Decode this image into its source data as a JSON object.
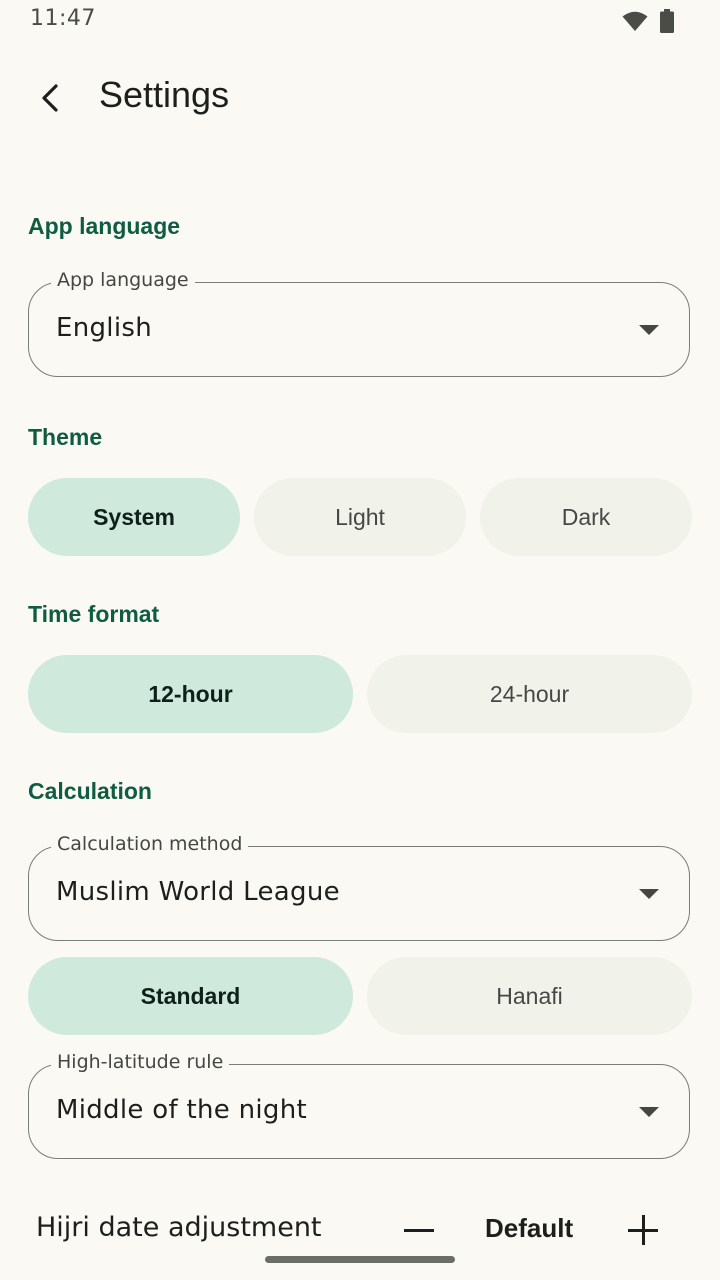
{
  "status_bar": {
    "time": "11:47",
    "icons": [
      "wifi-icon",
      "battery-icon"
    ]
  },
  "header": {
    "title": "Settings",
    "back_icon": "back-arrow-icon"
  },
  "sections": {
    "app_language": "App language",
    "theme": "Theme",
    "time_format": "Time format",
    "calculation": "Calculation"
  },
  "app_language_field": {
    "label": "App language",
    "value": "English"
  },
  "theme_options": {
    "system": "System",
    "light": "Light",
    "dark": "Dark",
    "selected": "System"
  },
  "time_format_options": {
    "h12": "12-hour",
    "h24": "24-hour",
    "selected": "12-hour"
  },
  "calculation_method_field": {
    "label": "Calculation method",
    "value": "Muslim World League"
  },
  "asr_options": {
    "standard": "Standard",
    "hanafi": "Hanafi",
    "selected": "Standard"
  },
  "high_latitude_field": {
    "label": "High-latitude rule",
    "value": "Middle of the night"
  },
  "hijri_adjustment": {
    "label": "Hijri date adjustment",
    "value": "Default"
  },
  "colors": {
    "accent": "#0f5c43",
    "selected_segment": "#cfe9dd",
    "unselected_segment": "#f1f2ea",
    "background": "#fbf9f4"
  }
}
